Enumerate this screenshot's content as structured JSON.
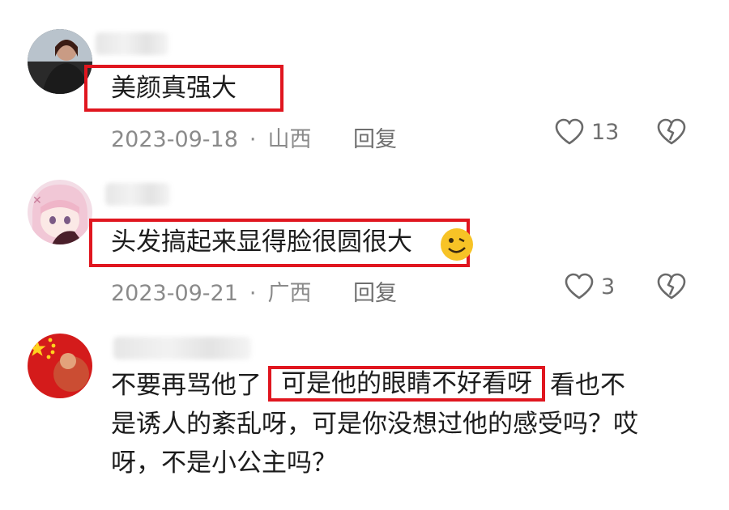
{
  "comments": [
    {
      "avatar_icon": "avatar-photo-woman",
      "text": "美颜真强大",
      "date": "2023-09-18",
      "region": "山西",
      "reply_label": "回复",
      "like_count": "13"
    },
    {
      "avatar_icon": "avatar-anime-girl",
      "text": "头发搞起来显得脸很圆很大",
      "date": "2023-09-21",
      "region": "广西",
      "reply_label": "回复",
      "like_count": "3"
    },
    {
      "avatar_icon": "avatar-flag",
      "line1_before": "不要再骂他了",
      "line1_highlight": "可是他的眼睛不好看呀",
      "line1_after": "看也不",
      "line2": "是诱人的紊乱呀，可是你没想过他的感受吗？哎",
      "line3": "呀，不是小公主吗？"
    }
  ],
  "separator": "·",
  "colors": {
    "highlight_border": "#e0161f",
    "meta_text": "#8a8a8a"
  }
}
